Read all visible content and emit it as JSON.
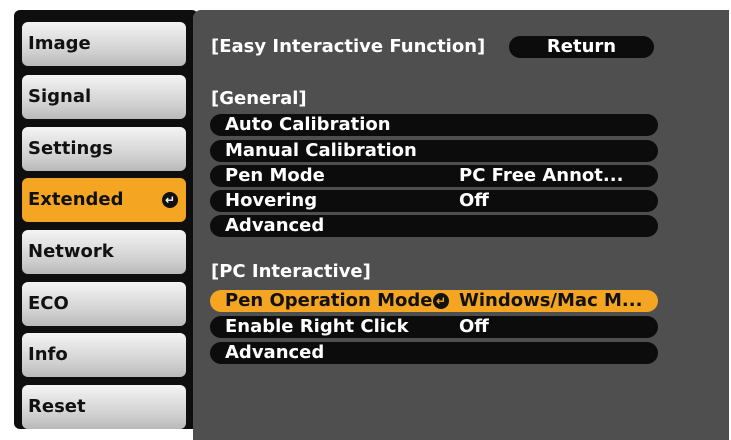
{
  "sidebar": {
    "items": [
      {
        "label": "Image"
      },
      {
        "label": "Signal"
      },
      {
        "label": "Settings"
      },
      {
        "label": "Extended",
        "active": true
      },
      {
        "label": "Network"
      },
      {
        "label": "ECO"
      },
      {
        "label": "Info"
      },
      {
        "label": "Reset"
      }
    ],
    "enter_glyph": "↵"
  },
  "panel": {
    "title": "[Easy Interactive Function]",
    "return_label": "Return",
    "general_header": "[General]",
    "general_items": [
      {
        "label": "Auto Calibration",
        "value": ""
      },
      {
        "label": "Manual Calibration",
        "value": ""
      },
      {
        "label": "Pen Mode",
        "value": "PC Free Annot..."
      },
      {
        "label": "Hovering",
        "value": "Off"
      },
      {
        "label": "Advanced",
        "value": ""
      }
    ],
    "pc_header": "[PC Interactive]",
    "pc_items": [
      {
        "label": "Pen Operation Mode",
        "value": "Windows/Mac M...",
        "selected": true
      },
      {
        "label": "Enable Right Click",
        "value": "Off"
      },
      {
        "label": "Advanced",
        "value": ""
      }
    ]
  },
  "colors": {
    "accent": "#f4a521",
    "panel_bg": "#4f4f4f",
    "row_bg": "#0c0c0c"
  },
  "icons": {
    "enter": "enter-icon"
  }
}
